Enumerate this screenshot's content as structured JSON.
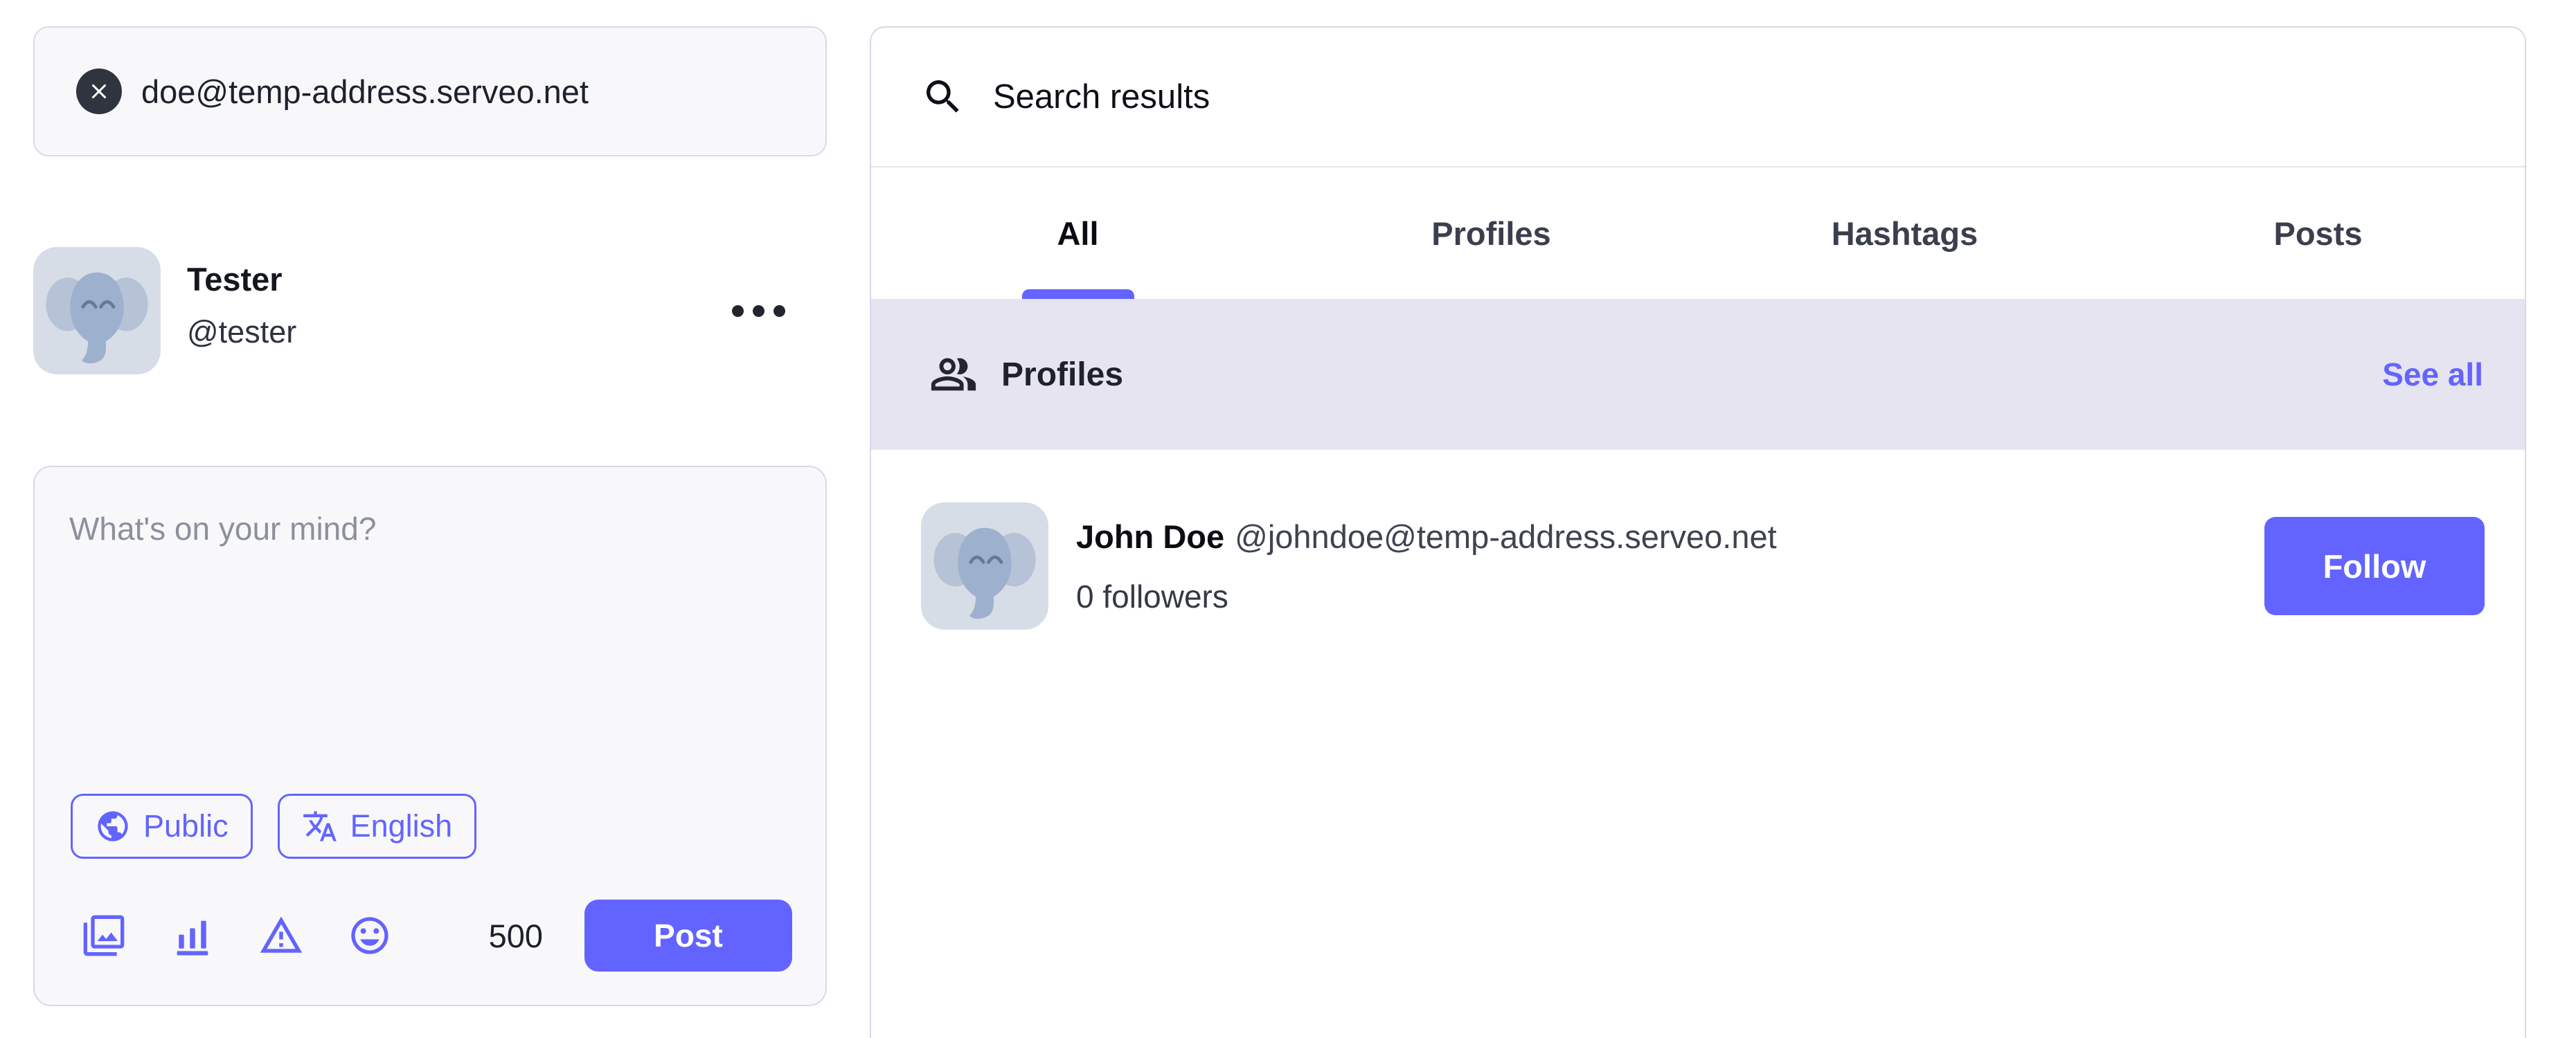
{
  "colors": {
    "accent": "#6364ff",
    "text_dark": "#21242e",
    "handle_gray": "#3e4350",
    "placeholder_gray": "#8b909c",
    "section_lavender": "#e6e4f0",
    "card_background": "#f8f8fb",
    "card_border": "#d9d8e6",
    "clear_button_dark": "#30343f"
  },
  "left": {
    "search": {
      "value": "doe@temp-address.serveo.net"
    },
    "profile": {
      "display_name": "Tester",
      "handle": "@tester"
    },
    "composer": {
      "placeholder": "What's on your mind?",
      "privacy_label": "Public",
      "language_label": "English",
      "char_count": "500",
      "post_label": "Post"
    }
  },
  "search_panel": {
    "title": "Search results",
    "tabs": [
      {
        "label": "All",
        "active": true
      },
      {
        "label": "Profiles",
        "active": false
      },
      {
        "label": "Hashtags",
        "active": false
      },
      {
        "label": "Posts",
        "active": false
      }
    ],
    "profiles_section": {
      "label": "Profiles",
      "see_all_label": "See all"
    },
    "results": [
      {
        "display_name": "John Doe",
        "handle": "@johndoe@temp-address.serveo.net",
        "followers": "0 followers",
        "follow_label": "Follow"
      }
    ]
  }
}
